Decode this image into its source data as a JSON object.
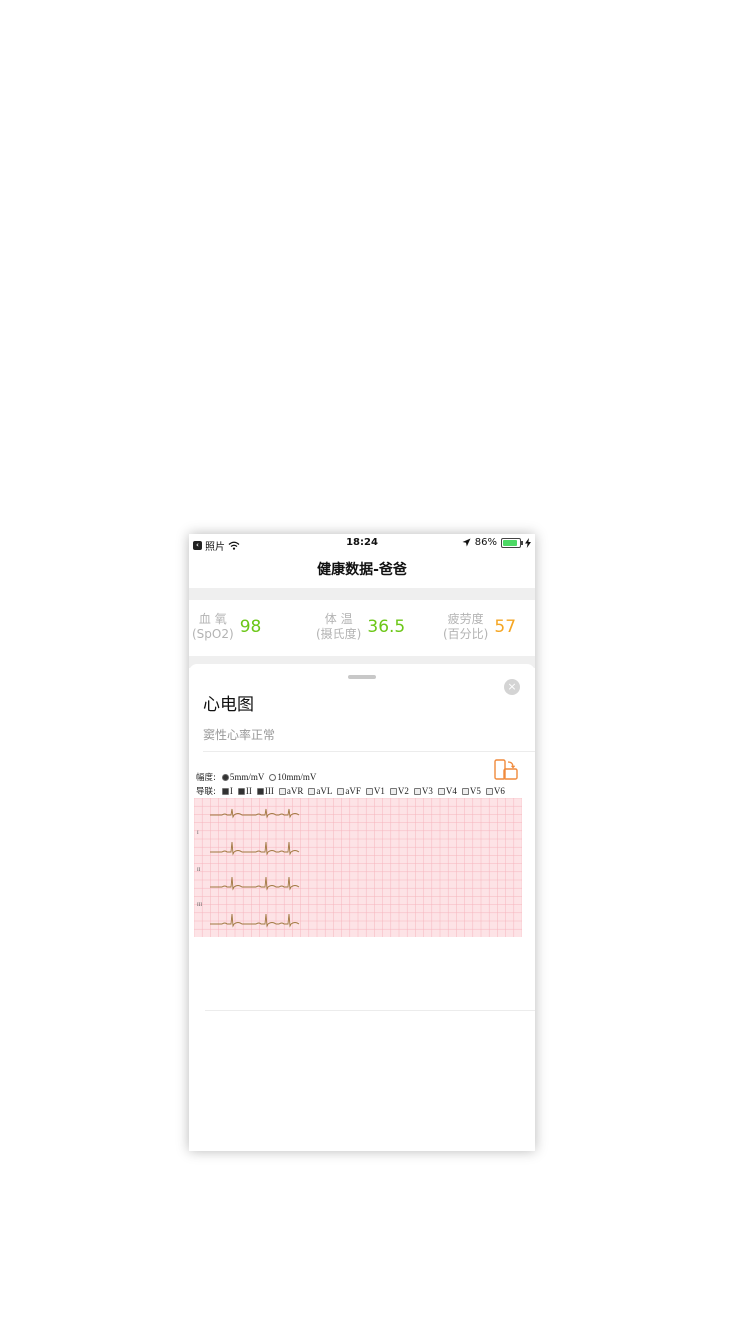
{
  "status_bar": {
    "back_app": "照片",
    "time": "18:24",
    "battery_percent": "86%",
    "battery_level": 0.86
  },
  "header": {
    "title": "健康数据-爸爸"
  },
  "metrics": [
    {
      "label_line1": "血 氧",
      "label_line2": "(SpO2)",
      "value": "98",
      "color": "#6cc718"
    },
    {
      "label_line1": "体 温",
      "label_line2": "(摄氏度)",
      "value": "36.5",
      "color": "#6cc718"
    },
    {
      "label_line1": "疲劳度",
      "label_line2": "(百分比)",
      "value": "57",
      "color": "#f5a623"
    }
  ],
  "ecg_sheet": {
    "title": "心电图",
    "subtitle": "窦性心率正常",
    "close_label": "×",
    "amplitude_label": "幅度:",
    "amplitude_options": [
      {
        "label": "5mm/mV",
        "selected": true
      },
      {
        "label": "10mm/mV",
        "selected": false
      }
    ],
    "leads_label": "导联:",
    "lead_options": [
      {
        "label": "I",
        "checked": true
      },
      {
        "label": "II",
        "checked": true
      },
      {
        "label": "III",
        "checked": true
      },
      {
        "label": "aVR",
        "checked": false
      },
      {
        "label": "aVL",
        "checked": false
      },
      {
        "label": "aVF",
        "checked": false
      },
      {
        "label": "V1",
        "checked": false
      },
      {
        "label": "V2",
        "checked": false
      },
      {
        "label": "V3",
        "checked": false
      },
      {
        "label": "V4",
        "checked": false
      },
      {
        "label": "V5",
        "checked": false
      },
      {
        "label": "V6",
        "checked": false
      }
    ],
    "trace_labels": [
      "I",
      "II",
      "III"
    ],
    "colors": {
      "grid_bg": "#fde3e6",
      "grid_line": "#f6b5bd",
      "trace": "#a0773f",
      "accent": "#f08a3c"
    }
  }
}
